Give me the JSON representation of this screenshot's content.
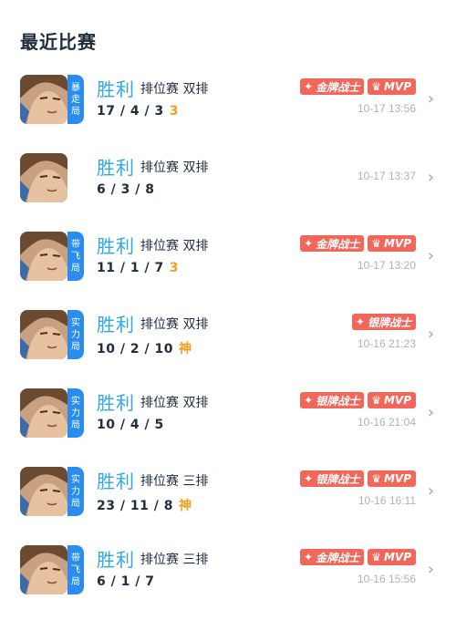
{
  "section_title": "最近比赛",
  "matches": [
    {
      "mode_tag": "暴走局",
      "result": "胜利",
      "queue": "排位赛 双排",
      "kda": "17 / 4 / 3",
      "streak": "3",
      "badges": [
        "金牌战士",
        "MVP"
      ],
      "time": "10-17 13:56"
    },
    {
      "mode_tag": "",
      "result": "胜利",
      "queue": "排位赛 双排",
      "kda": "6 / 3 / 8",
      "streak": "",
      "badges": [],
      "time": "10-17 13:37"
    },
    {
      "mode_tag": "带飞局",
      "result": "胜利",
      "queue": "排位赛 双排",
      "kda": "11 / 1 / 7",
      "streak": "3",
      "badges": [
        "金牌战士",
        "MVP"
      ],
      "time": "10-17 13:20"
    },
    {
      "mode_tag": "实力局",
      "result": "胜利",
      "queue": "排位赛 双排",
      "kda": "10 / 2 / 10",
      "streak": "神",
      "badges": [
        "银牌战士"
      ],
      "time": "10-16 21:23"
    },
    {
      "mode_tag": "实力局",
      "result": "胜利",
      "queue": "排位赛 双排",
      "kda": "10 / 4 / 5",
      "streak": "",
      "badges": [
        "银牌战士",
        "MVP"
      ],
      "time": "10-16 21:04"
    },
    {
      "mode_tag": "实力局",
      "result": "胜利",
      "queue": "排位赛 三排",
      "kda": "23 / 11 / 8",
      "streak": "神",
      "badges": [
        "银牌战士",
        "MVP"
      ],
      "time": "10-16 16:11"
    },
    {
      "mode_tag": "带飞局",
      "result": "胜利",
      "queue": "排位赛 三排",
      "kda": "6 / 1 / 7",
      "streak": "",
      "badges": [
        "金牌战士",
        "MVP"
      ],
      "time": "10-16 15:56"
    }
  ],
  "colors": {
    "win": "#2ea8e8",
    "tag_bg": "#2b8cf0",
    "badge_bg": "#f3675a",
    "streak": "#f0a020"
  },
  "icons": {
    "badge_warrior": "medal-icon",
    "badge_mvp": "trophy-icon",
    "chevron": "chevron-right-icon"
  }
}
